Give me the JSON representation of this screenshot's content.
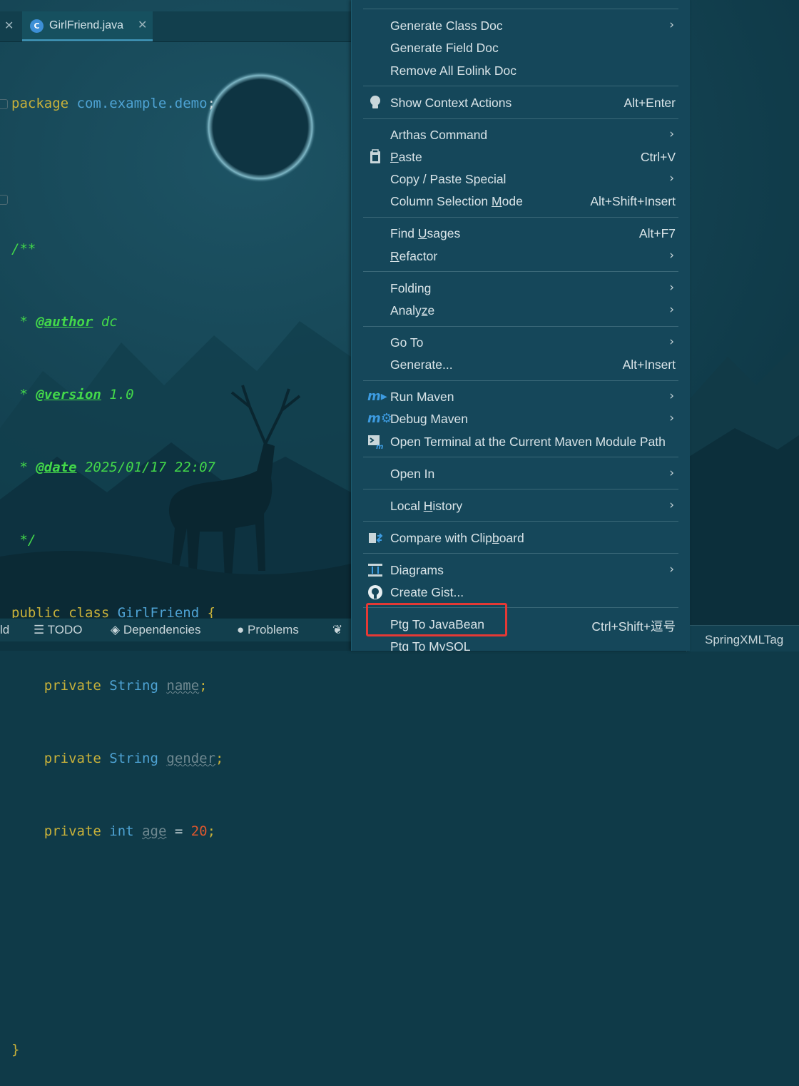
{
  "editor": {
    "tab_title": "GirlFriend.java",
    "tab_icon_letter": "C",
    "code": {
      "package_kw": "package",
      "package_name": "com.example.demo",
      "semicolon": ";",
      "doc_open": "/**",
      "doc_star": " * ",
      "author_tag": "@author",
      "author_val": " dc",
      "version_tag": "@version",
      "version_val": " 1.0",
      "date_tag": "@date",
      "date_val": " 2025/01/17 22:07",
      "doc_close": " */",
      "public_kw": "public",
      "class_kw": "class",
      "class_name": "GirlFriend",
      "brace_open": "{",
      "brace_close": "}",
      "private_kw": "private",
      "string_type": "String",
      "int_type": "int",
      "field_name": "name",
      "field_gender": "gender",
      "field_age": "age",
      "equals": " = ",
      "age_value": "20"
    }
  },
  "bottom_bar": {
    "partial_label": "ld",
    "todo": "TODO",
    "dependencies": "Dependencies",
    "problems": "Problems",
    "spring_tag": "SpringXMLTag"
  },
  "menu": {
    "items": [
      {
        "label": "Generate Class Doc",
        "shortcut": "",
        "arrow": true
      },
      {
        "label": "Generate Field Doc",
        "shortcut": "",
        "arrow": false
      },
      {
        "label": "Remove All Eolink Doc",
        "shortcut": "",
        "arrow": false
      },
      {
        "label": "Show Context Actions",
        "shortcut": "Alt+Enter",
        "arrow": false
      },
      {
        "label": "Arthas Command",
        "shortcut": "",
        "arrow": true
      },
      {
        "label": "Paste",
        "shortcut": "Ctrl+V",
        "arrow": false
      },
      {
        "label": "Copy / Paste Special",
        "shortcut": "",
        "arrow": true
      },
      {
        "label": "Column Selection Mode",
        "shortcut": "Alt+Shift+Insert",
        "arrow": false
      },
      {
        "label": "Find Usages",
        "shortcut": "Alt+F7",
        "arrow": false
      },
      {
        "label": "Refactor",
        "shortcut": "",
        "arrow": true
      },
      {
        "label": "Folding",
        "shortcut": "",
        "arrow": true
      },
      {
        "label": "Analyze",
        "shortcut": "",
        "arrow": true
      },
      {
        "label": "Go To",
        "shortcut": "",
        "arrow": true
      },
      {
        "label": "Generate...",
        "shortcut": "Alt+Insert",
        "arrow": false
      },
      {
        "label": "Run Maven",
        "shortcut": "",
        "arrow": true
      },
      {
        "label": "Debug Maven",
        "shortcut": "",
        "arrow": true
      },
      {
        "label": "Open Terminal at the Current Maven Module Path",
        "shortcut": "",
        "arrow": false
      },
      {
        "label": "Open In",
        "shortcut": "",
        "arrow": true
      },
      {
        "label": "Local History",
        "shortcut": "",
        "arrow": true
      },
      {
        "label": "Compare with Clipboard",
        "shortcut": "",
        "arrow": false
      },
      {
        "label": "Diagrams",
        "shortcut": "",
        "arrow": true
      },
      {
        "label": "Create Gist...",
        "shortcut": "",
        "arrow": false
      },
      {
        "label": "Ptg To JavaBean",
        "shortcut": "Ctrl+Shift+逗号",
        "arrow": false
      },
      {
        "label": "Ptg To MySQL",
        "shortcut": "",
        "arrow": false
      }
    ]
  },
  "icons": {
    "bulb": "lightbulb-icon",
    "paste": "clipboard-icon",
    "maven": "maven-icon",
    "terminal": "terminal-icon",
    "compare": "compare-icon",
    "diagram": "diagram-icon",
    "github": "github-icon"
  },
  "colors": {
    "highlight_box": "#e53935",
    "menu_bg": "#15475a"
  }
}
